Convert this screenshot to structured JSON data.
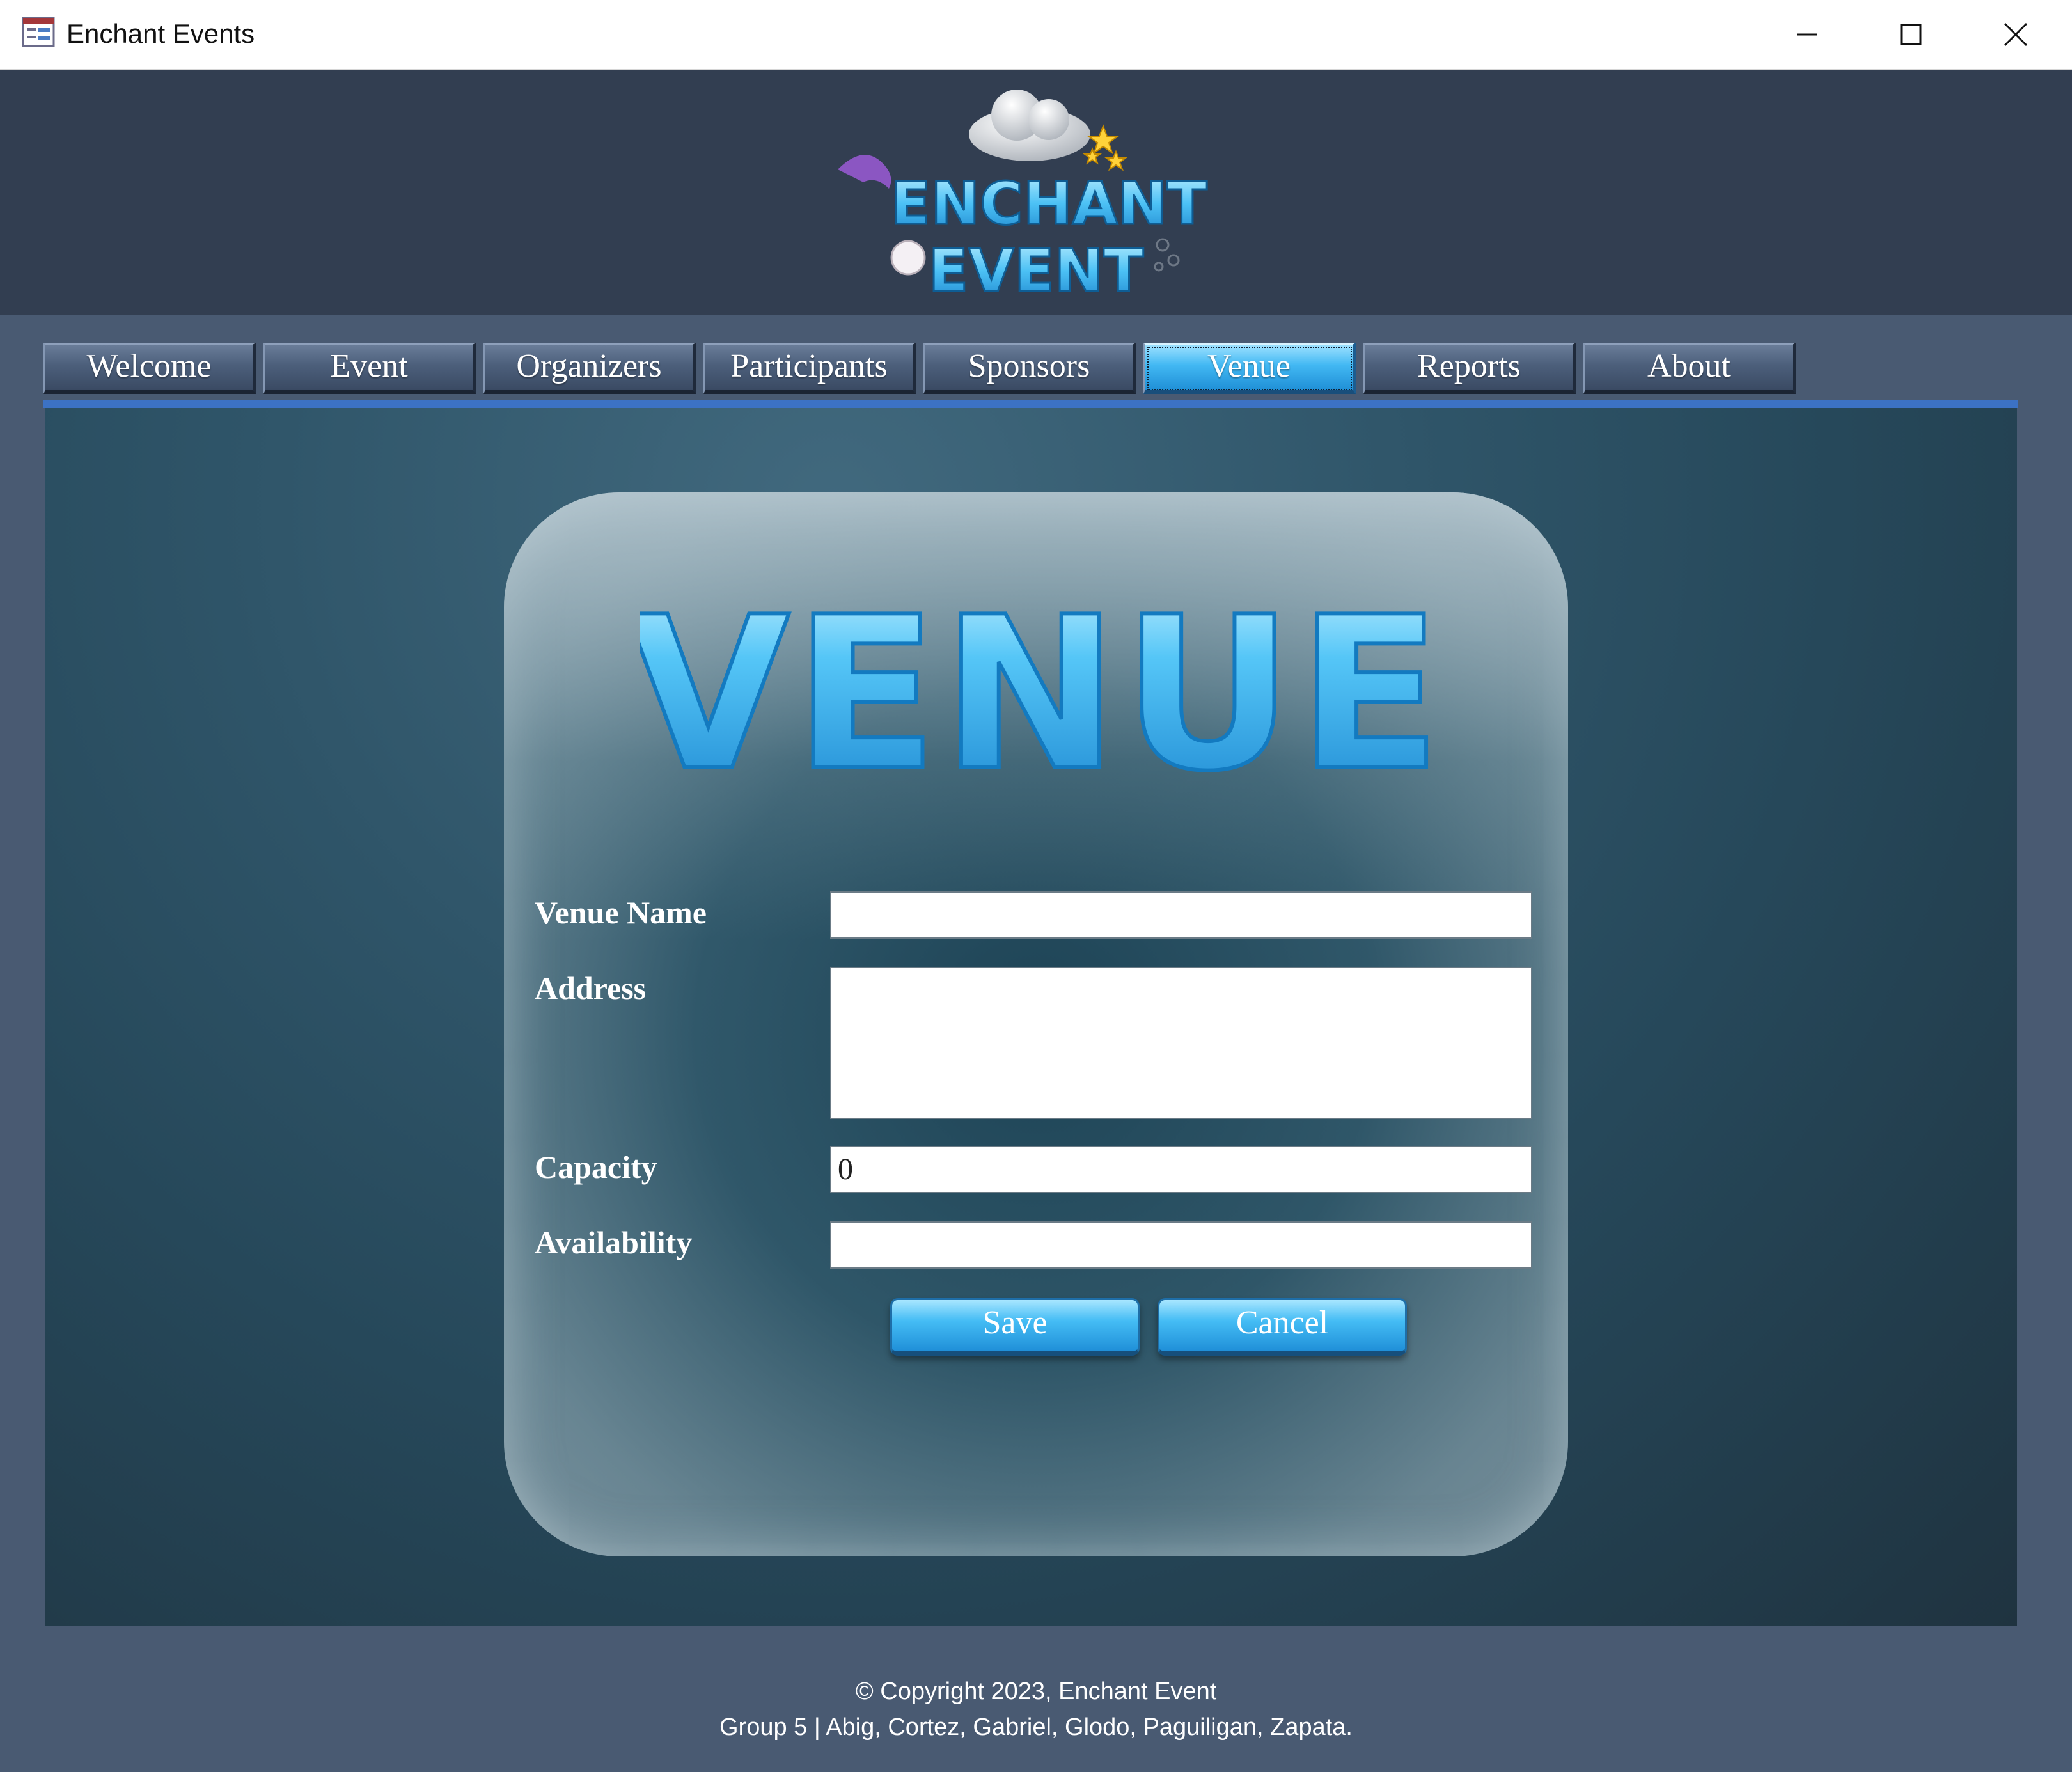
{
  "window": {
    "title": "Enchant Events",
    "icon": "access-form-icon",
    "controls": [
      "minimize-icon",
      "maximize-icon",
      "close-icon"
    ]
  },
  "header": {
    "logo_line1": "ENCHANT",
    "logo_line2": "EVENT"
  },
  "tabs": [
    {
      "label": "Welcome",
      "active": false
    },
    {
      "label": "Event",
      "active": false
    },
    {
      "label": "Organizers",
      "active": false
    },
    {
      "label": "Participants",
      "active": false
    },
    {
      "label": "Sponsors",
      "active": false
    },
    {
      "label": "Venue",
      "active": true
    },
    {
      "label": "Reports",
      "active": false
    },
    {
      "label": "About",
      "active": false
    }
  ],
  "form": {
    "heading": "VENUE",
    "fields": {
      "venue_name": {
        "label": "Venue Name",
        "value": ""
      },
      "address": {
        "label": "Address",
        "value": ""
      },
      "capacity": {
        "label": "Capacity",
        "value": "0"
      },
      "availability": {
        "label": "Availability",
        "value": ""
      }
    },
    "save_label": "Save",
    "cancel_label": "Cancel"
  },
  "footer": {
    "copyright": "© Copyright 2023, Enchant Event",
    "credits": "Group 5 | Abig, Cortez, Gabriel, Glodo, Paguiligan, Zapata."
  },
  "colors": {
    "header_bg": "#323e51",
    "frame_bg": "#495a72",
    "tab_accent": "#3c72c4",
    "bubble_text": "#3fb4f0"
  }
}
